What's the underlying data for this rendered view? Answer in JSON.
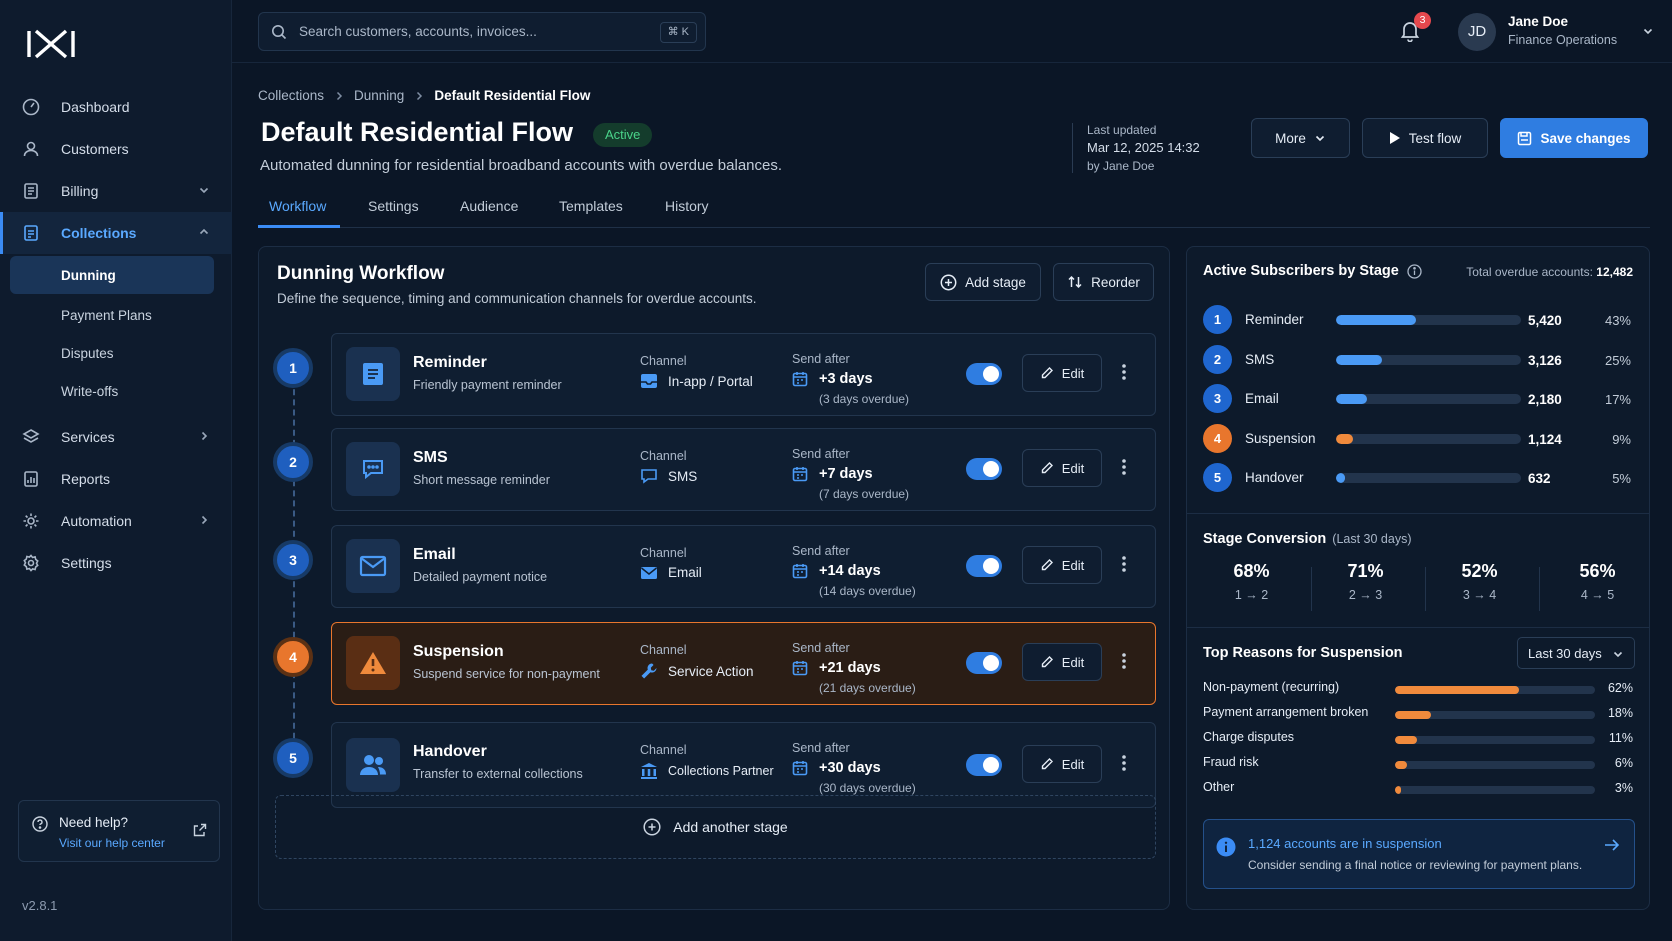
{
  "app": {
    "version": "v2.8.1"
  },
  "nav": {
    "items": [
      {
        "label": "Dashboard",
        "icon": "dashboard-icon"
      },
      {
        "label": "Customers",
        "icon": "customers-icon"
      },
      {
        "label": "Billing",
        "icon": "billing-icon"
      },
      {
        "label": "Collections",
        "icon": "collections-icon"
      },
      {
        "label": "Services",
        "icon": "services-icon"
      },
      {
        "label": "Reports",
        "icon": "reports-icon"
      },
      {
        "label": "Automation",
        "icon": "automation-icon"
      },
      {
        "label": "Settings",
        "icon": "settings-icon"
      }
    ],
    "collections_sub": [
      "Dunning",
      "Payment Plans",
      "Disputes",
      "Write-offs"
    ],
    "help_title": "Need help?",
    "help_link": "Visit our help center"
  },
  "topbar": {
    "search_placeholder": "Search customers, accounts, invoices...",
    "shortcut": "⌘ K",
    "notifications": "3",
    "user_initials": "JD",
    "user_name": "Jane Doe",
    "user_role": "Finance Operations"
  },
  "header": {
    "breadcrumb": [
      "Collections",
      "Dunning",
      "Default Residential Flow"
    ],
    "title": "Default Residential Flow",
    "status": "Active",
    "description": "Automated dunning for residential broadband accounts with overdue balances.",
    "last_updated_label": "Last updated",
    "last_updated": "Mar 12, 2025 14:32",
    "updated_by": "by Jane Doe",
    "more": "More",
    "test_flow": "Test flow",
    "save": "Save changes"
  },
  "tabs": [
    "Workflow",
    "Settings",
    "Audience",
    "Templates",
    "History"
  ],
  "workflow": {
    "title": "Dunning Workflow",
    "description": "Define the sequence, timing and communication channels for overdue accounts.",
    "add_stage": "Add stage",
    "reorder": "Reorder",
    "channel_label": "Channel",
    "send_after_label": "Send after",
    "edit": "Edit",
    "add_another": "Add another stage",
    "stages": [
      {
        "num": "1",
        "name": "Reminder",
        "desc": "Friendly payment reminder",
        "channel": "In-app / Portal",
        "send": "+3 days",
        "overdue": "(3 days overdue)",
        "enabled": true
      },
      {
        "num": "2",
        "name": "SMS",
        "desc": "Short message reminder",
        "channel": "SMS",
        "send": "+7 days",
        "overdue": "(7 days overdue)",
        "enabled": true
      },
      {
        "num": "3",
        "name": "Email",
        "desc": "Detailed payment notice",
        "channel": "Email",
        "send": "+14 days",
        "overdue": "(14 days overdue)",
        "enabled": true
      },
      {
        "num": "4",
        "name": "Suspension",
        "desc": "Suspend service for non-payment",
        "channel": "Service Action",
        "send": "+21 days",
        "overdue": "(21 days overdue)",
        "enabled": true
      },
      {
        "num": "5",
        "name": "Handover",
        "desc": "Transfer to external collections",
        "channel": "Collections Partner",
        "send": "+30 days",
        "overdue": "(30 days overdue)",
        "enabled": true
      }
    ]
  },
  "subscribers": {
    "title": "Active Subscribers by Stage",
    "total_label": "Total overdue accounts:",
    "total": "12,482",
    "rows": [
      {
        "num": "1",
        "label": "Reminder",
        "value": "5,420",
        "pct": "43%",
        "fraction": 0.43
      },
      {
        "num": "2",
        "label": "SMS",
        "value": "3,126",
        "pct": "25%",
        "fraction": 0.25
      },
      {
        "num": "3",
        "label": "Email",
        "value": "2,180",
        "pct": "17%",
        "fraction": 0.17
      },
      {
        "num": "4",
        "label": "Suspension",
        "value": "1,124",
        "pct": "9%",
        "fraction": 0.09
      },
      {
        "num": "5",
        "label": "Handover",
        "value": "632",
        "pct": "5%",
        "fraction": 0.05
      }
    ]
  },
  "conversion": {
    "title": "Stage Conversion",
    "period": "(Last 30 days)",
    "items": [
      {
        "pct": "68%",
        "step": "1 → 2"
      },
      {
        "pct": "71%",
        "step": "2 → 3"
      },
      {
        "pct": "52%",
        "step": "3 → 4"
      },
      {
        "pct": "56%",
        "step": "4 → 5"
      }
    ]
  },
  "reasons": {
    "title": "Top Reasons for Suspension",
    "period_select": "Last 30 days",
    "items": [
      {
        "label": "Non-payment (recurring)",
        "pct": "62%",
        "fraction": 0.62
      },
      {
        "label": "Payment arrangement broken",
        "pct": "18%",
        "fraction": 0.18
      },
      {
        "label": "Charge disputes",
        "pct": "11%",
        "fraction": 0.11
      },
      {
        "label": "Fraud risk",
        "pct": "6%",
        "fraction": 0.06
      },
      {
        "label": "Other",
        "pct": "3%",
        "fraction": 0.03
      }
    ]
  },
  "alert": {
    "title": "1,124 accounts are in suspension",
    "body": "Consider sending a final notice or reviewing for payment plans."
  },
  "colors": {
    "accent": "#2f7de1",
    "warning": "#e8762d",
    "success": "#4ad38a",
    "background": "#0b1626"
  }
}
